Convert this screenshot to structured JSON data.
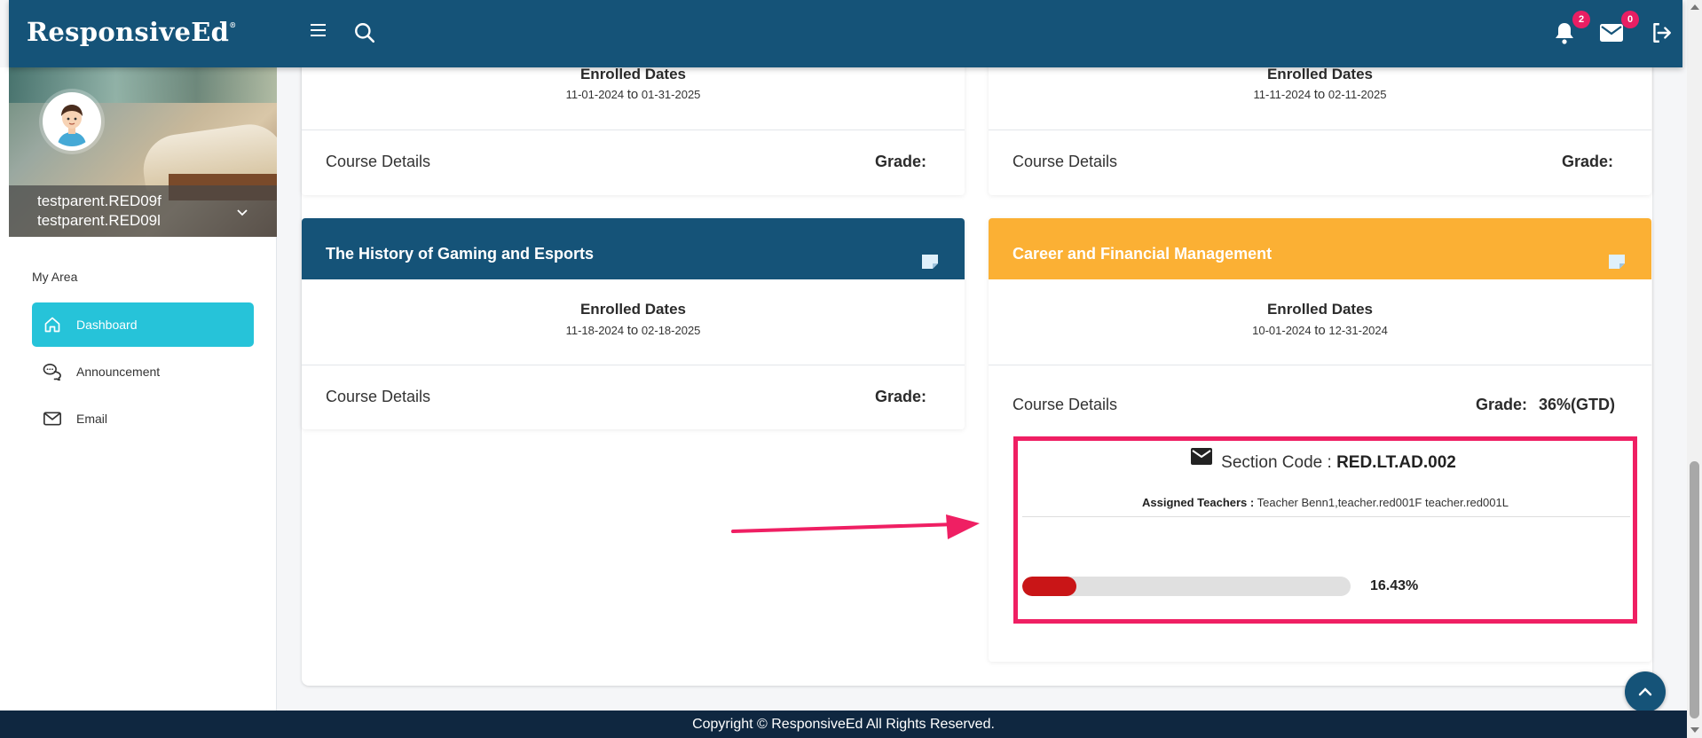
{
  "header": {
    "logo": "ResponsiveEd",
    "logo_mark": "®",
    "notifications_count": "2",
    "messages_count": "0",
    "icons": [
      "menu-icon",
      "search-icon",
      "bell-icon",
      "mail-icon",
      "logout-icon"
    ]
  },
  "sidebar": {
    "user": {
      "name_line1": "testparent.RED09f",
      "name_line2": "testparent.RED09l"
    },
    "section_title": "My Area",
    "items": [
      {
        "label": "Dashboard",
        "icon": "home-icon",
        "active": true
      },
      {
        "label": "Announcement",
        "icon": "chat-icon",
        "active": false
      },
      {
        "label": "Email",
        "icon": "envelope-icon",
        "active": false
      }
    ]
  },
  "courses": [
    {
      "enrolled_label": "Enrolled Dates",
      "start": "11-01-2024",
      "to": "to",
      "end": "01-31-2025",
      "details_label": "Course Details",
      "grade_label": "Grade:",
      "grade_value": ""
    },
    {
      "enrolled_label": "Enrolled Dates",
      "start": "11-11-2024",
      "to": "to",
      "end": "02-11-2025",
      "details_label": "Course Details",
      "grade_label": "Grade:",
      "grade_value": ""
    },
    {
      "title": "The History of Gaming and Esports",
      "header_color": "#155378",
      "enrolled_label": "Enrolled Dates",
      "start": "11-18-2024",
      "to": "to",
      "end": "02-18-2025",
      "details_label": "Course Details",
      "grade_label": "Grade:",
      "grade_value": ""
    },
    {
      "title": "Career and Financial Management",
      "header_color": "#fbb034",
      "enrolled_label": "Enrolled Dates",
      "start": "10-01-2024",
      "to": "to",
      "end": "12-31-2024",
      "details_label": "Course Details",
      "grade_label": "Grade:",
      "grade_value": "36%(GTD)",
      "section": {
        "code_label": "Section Code :",
        "code_value": "RED.LT.AD.002",
        "teachers_label": "Assigned Teachers :",
        "teachers_value": "Teacher Benn1,teacher.red001F teacher.red001L",
        "progress_percent": 16.43,
        "progress_text": "16.43%"
      }
    }
  ],
  "footer": {
    "copyright": "Copyright © ResponsiveEd All Rights Reserved."
  },
  "colors": {
    "primary": "#155378",
    "accent": "#26c3d9",
    "orange": "#fbb034",
    "highlight": "#ef1f63",
    "progress": "#c91517"
  }
}
